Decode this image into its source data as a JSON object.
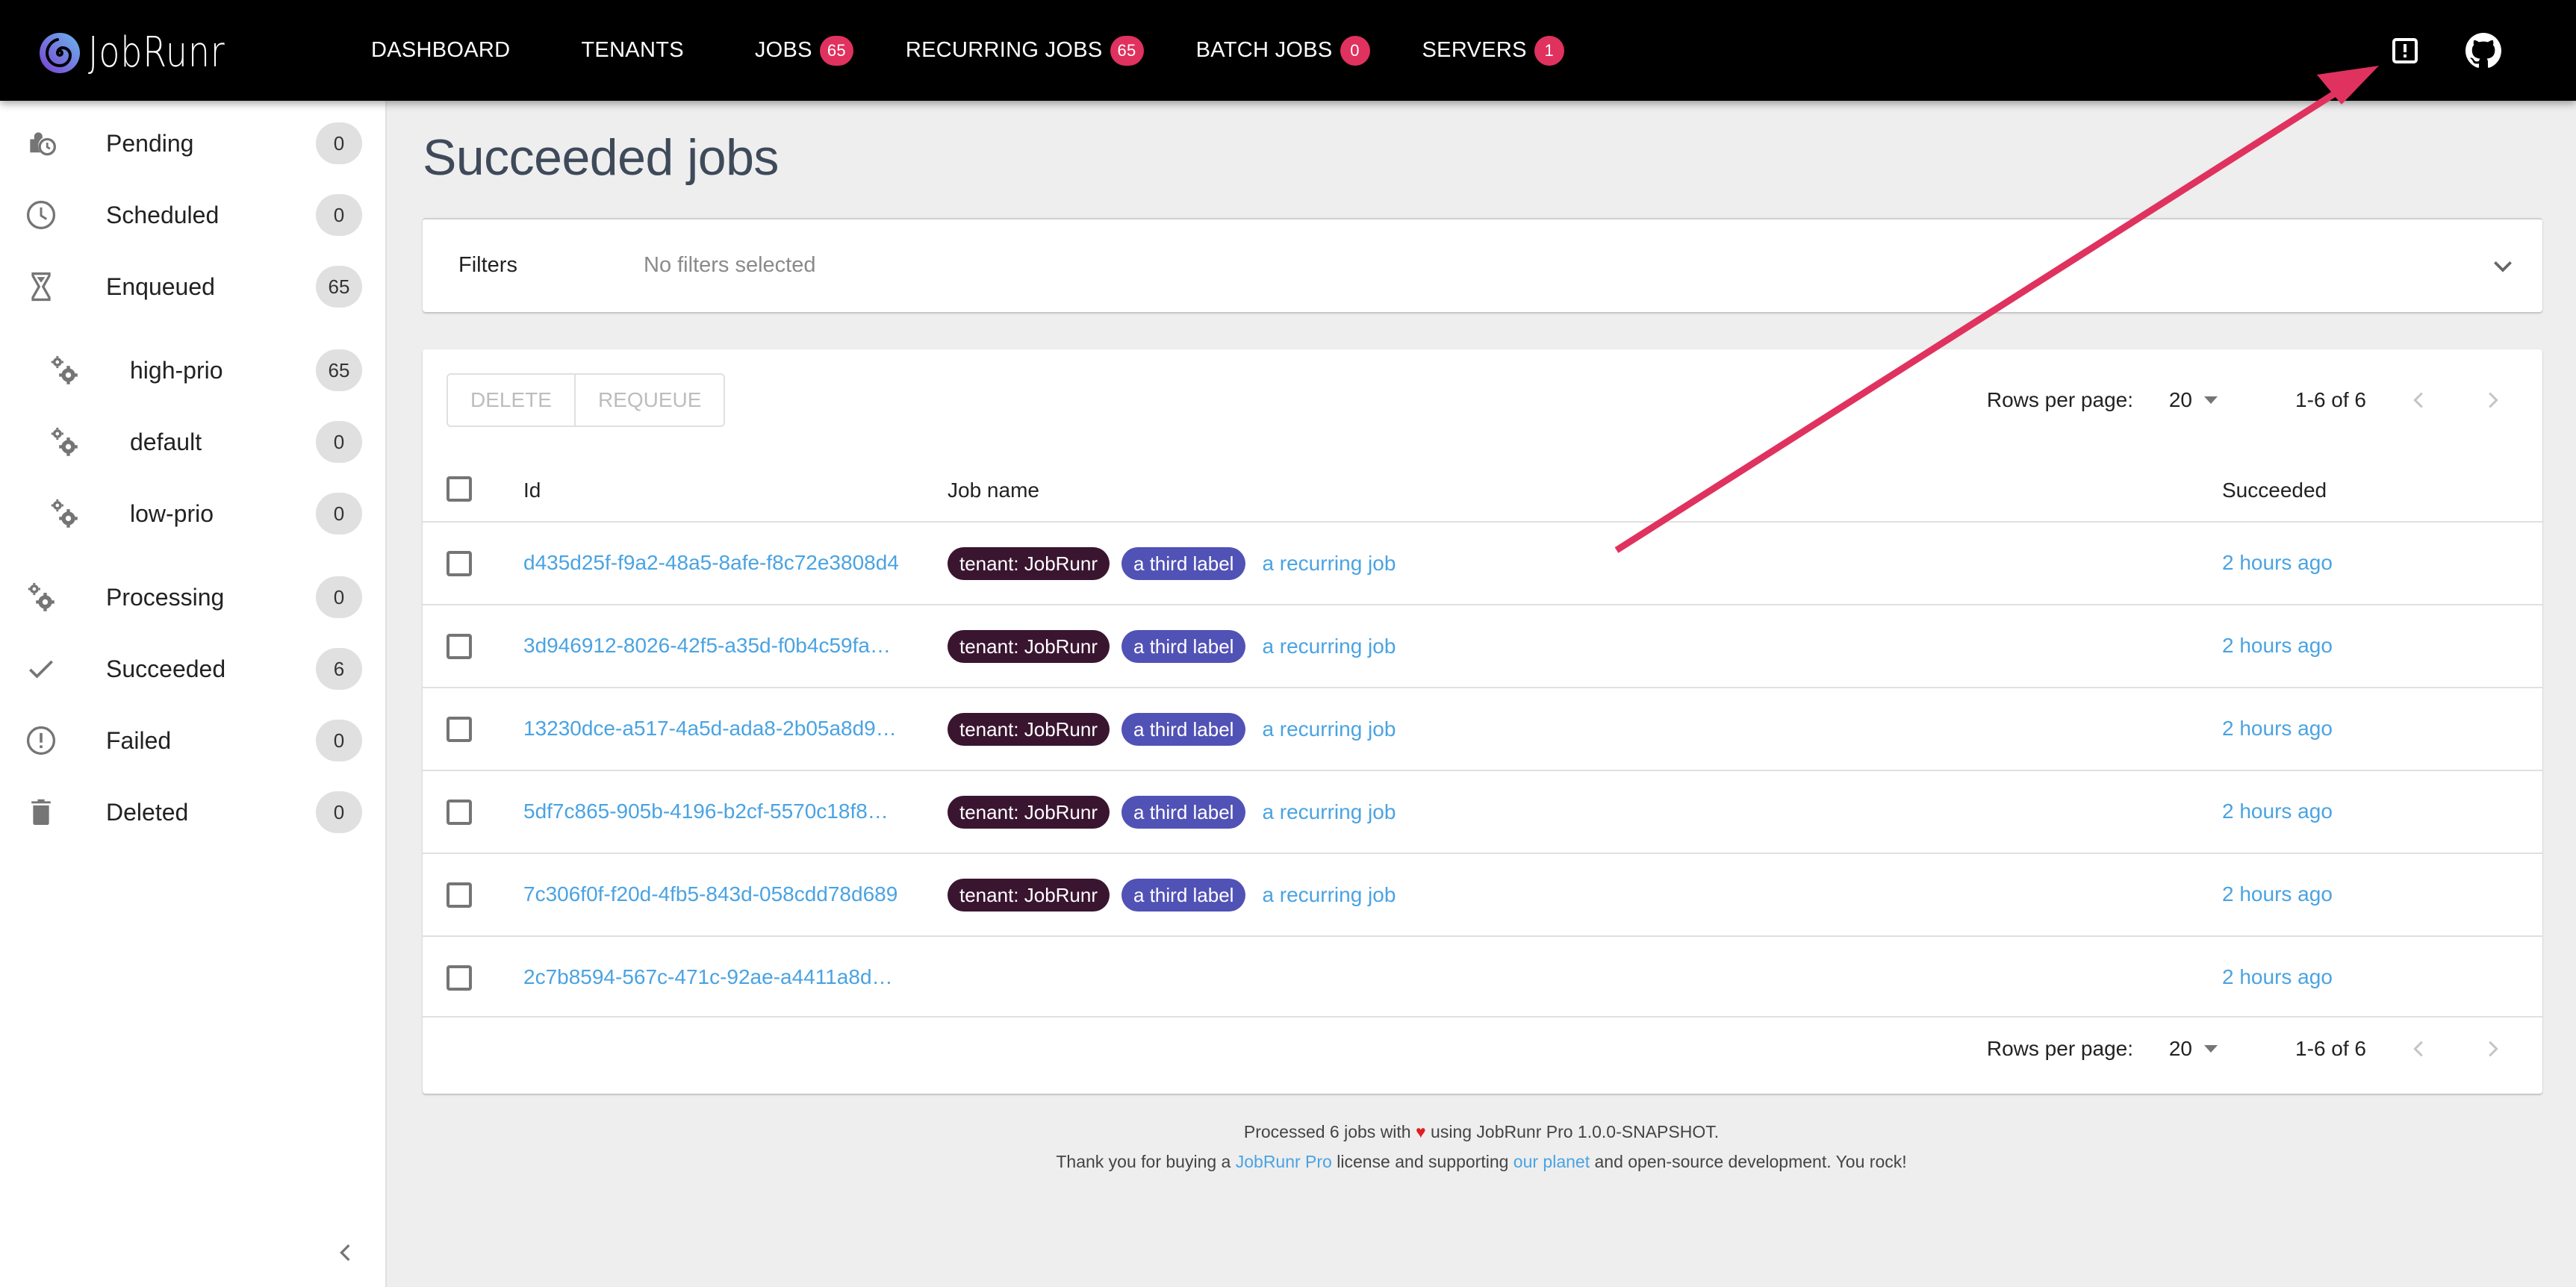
{
  "app": {
    "brand": "JobRunr",
    "accent_color": "#e0325f",
    "link_color": "#4aa3e2"
  },
  "nav": {
    "items": [
      {
        "label": "Dashboard"
      },
      {
        "label": "Tenants"
      },
      {
        "label": "Jobs",
        "badge": "65"
      },
      {
        "label": "Recurring Jobs",
        "badge": "65"
      },
      {
        "label": "Batch Jobs",
        "badge": "0"
      },
      {
        "label": "Servers",
        "badge": "1"
      }
    ],
    "icons": [
      "report-problem-icon",
      "github-icon"
    ]
  },
  "sidebar": {
    "items": [
      {
        "label": "Pending",
        "count": "0",
        "icon": "pending-icon"
      },
      {
        "label": "Scheduled",
        "count": "0",
        "icon": "clock-icon"
      },
      {
        "label": "Enqueued",
        "count": "65",
        "icon": "hourglass-icon"
      },
      {
        "label": "high-prio",
        "count": "65",
        "icon": "gears-icon",
        "sub": true
      },
      {
        "label": "default",
        "count": "0",
        "icon": "gears-icon",
        "sub": true
      },
      {
        "label": "low-prio",
        "count": "0",
        "icon": "gears-icon",
        "sub": true
      },
      {
        "label": "Processing",
        "count": "0",
        "icon": "gears-icon"
      },
      {
        "label": "Succeeded",
        "count": "6",
        "icon": "check-icon"
      },
      {
        "label": "Failed",
        "count": "0",
        "icon": "error-icon"
      },
      {
        "label": "Deleted",
        "count": "0",
        "icon": "trash-icon"
      }
    ]
  },
  "main": {
    "title": "Succeeded jobs",
    "filters": {
      "label": "Filters",
      "value": "No filters selected"
    },
    "actions": {
      "delete_label": "Delete",
      "requeue_label": "Requeue"
    },
    "pagination": {
      "rows_per_page_label": "Rows per page:",
      "rows_per_page": "20",
      "range": "1-6 of 6"
    },
    "table": {
      "columns": [
        "Id",
        "Job name",
        "Succeeded"
      ],
      "rows": [
        {
          "id": "d435d25f-f9a2-48a5-8afe-f8c72e3808d4",
          "labels": [
            "tenant: JobRunr",
            "a third label"
          ],
          "job_name": "a recurring job",
          "succeeded": "2 hours ago"
        },
        {
          "id": "3d946912-8026-42f5-a35d-f0b4c59fa…",
          "labels": [
            "tenant: JobRunr",
            "a third label"
          ],
          "job_name": "a recurring job",
          "succeeded": "2 hours ago"
        },
        {
          "id": "13230dce-a517-4a5d-ada8-2b05a8d9…",
          "labels": [
            "tenant: JobRunr",
            "a third label"
          ],
          "job_name": "a recurring job",
          "succeeded": "2 hours ago"
        },
        {
          "id": "5df7c865-905b-4196-b2cf-5570c18f8…",
          "labels": [
            "tenant: JobRunr",
            "a third label"
          ],
          "job_name": "a recurring job",
          "succeeded": "2 hours ago"
        },
        {
          "id": "7c306f0f-f20d-4fb5-843d-058cdd78d689",
          "labels": [
            "tenant: JobRunr",
            "a third label"
          ],
          "job_name": "a recurring job",
          "succeeded": "2 hours ago"
        },
        {
          "id": "2c7b8594-567c-471c-92ae-a4411a8d…",
          "labels": [],
          "job_name": "",
          "succeeded": "2 hours ago"
        }
      ]
    }
  },
  "footer": {
    "line1_prefix": "Processed 6 jobs with ",
    "heart": "♥",
    "line1_suffix": " using JobRunr Pro 1.0.0-SNAPSHOT.",
    "line2_a": "Thank you for buying a ",
    "line2_link1": "JobRunr Pro",
    "line2_b": " license and supporting ",
    "line2_link2": "our planet",
    "line2_c": " and open-source development. You rock!"
  },
  "annotation": {
    "type": "arrow",
    "color": "#e0325f",
    "points_to": "report-problem-icon"
  }
}
